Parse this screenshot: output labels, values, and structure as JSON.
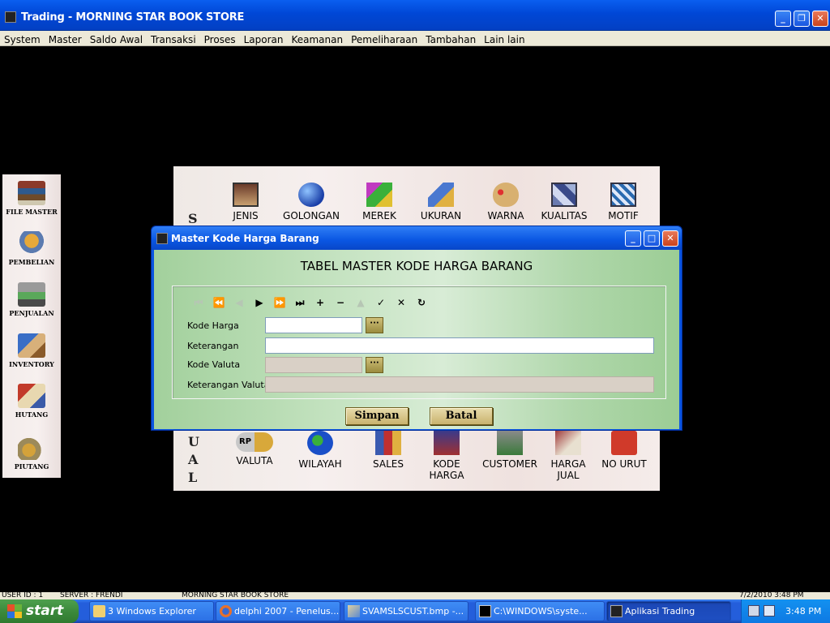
{
  "app": {
    "title": "Trading - MORNING STAR BOOK STORE",
    "menu": [
      "System",
      "Master",
      "Saldo Awal",
      "Transaksi",
      "Proses",
      "Laporan",
      "Keamanan",
      "Pemeliharaan",
      "Tambahan",
      "Lain lain"
    ]
  },
  "left_panel": {
    "items": [
      "FILE MASTER",
      "PEMBELIAN",
      "PENJUALAN",
      "INVENTORY",
      "HUTANG",
      "PIUTANG"
    ]
  },
  "main_panel": {
    "top_row": [
      "JENIS",
      "GOLONGAN",
      "MEREK",
      "UKURAN",
      "WARNA",
      "KUALITAS",
      "MOTIF"
    ],
    "bottom_row": [
      "VALUTA",
      "WILAYAH",
      "SALES",
      "KODE HARGA",
      "CUSTOMER",
      "HARGA JUAL",
      "NO URUT"
    ],
    "side_letters": [
      "S",
      "U",
      "A",
      "L"
    ],
    "icon_texts": {
      "valuta": "RP"
    }
  },
  "dialog": {
    "title": "Master Kode Harga Barang",
    "heading": "TABEL MASTER KODE HARGA BARANG",
    "fields": {
      "kode_harga": {
        "label": "Kode Harga",
        "value": ""
      },
      "keterangan": {
        "label": "Keterangan",
        "value": ""
      },
      "kode_valuta": {
        "label": "Kode Valuta",
        "value": ""
      },
      "keterangan_valuta": {
        "label": "Keterangan Valuta",
        "value": ""
      }
    },
    "nav_icons": [
      "first-icon",
      "prior-page-icon",
      "prior-icon",
      "next-icon",
      "next-page-icon",
      "last-icon",
      "insert-icon",
      "delete-icon",
      "edit-icon",
      "post-icon",
      "cancel-icon",
      "refresh-icon"
    ],
    "buttons": {
      "save": "Simpan",
      "cancel": "Batal"
    }
  },
  "status_bar": {
    "user": "USER ID : 1",
    "server": "SERVER : FRENDI",
    "company": "MORNING STAR BOOK STORE",
    "datetime": "7/2/2010 3:48 PM"
  },
  "taskbar": {
    "start": "start",
    "items": [
      "3 Windows Explorer",
      "delphi 2007 - Penelus...",
      "SVAMSLSCUST.bmp -...",
      "C:\\WINDOWS\\syste...",
      "Aplikasi Trading"
    ],
    "clock": "3:48 PM"
  },
  "colors": {
    "titlebar": "#0a55e0",
    "dialog_body": "#b8dcb3",
    "taskbar": "#245edb",
    "start": "#3c8a3c"
  }
}
